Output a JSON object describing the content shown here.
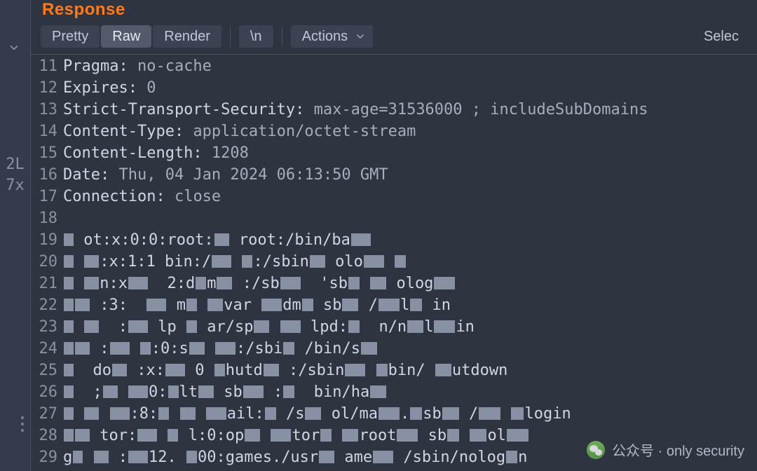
{
  "leftbar": {
    "mark1": "2L",
    "mark2": "7x"
  },
  "header": {
    "title": "Response"
  },
  "toolbar": {
    "pretty": "Pretty",
    "raw": "Raw",
    "render": "Render",
    "newline": "\\n",
    "actions": "Actions",
    "select": "Selec"
  },
  "lines": [
    {
      "n": 11,
      "type": "hdr",
      "key": "Pragma:",
      "val": " no-cache"
    },
    {
      "n": 12,
      "type": "hdr",
      "key": "Expires:",
      "val": " 0"
    },
    {
      "n": 13,
      "type": "hdr",
      "key": "Strict-Transport-Security:",
      "val": " max-age=31536000 ; includeSubDomains"
    },
    {
      "n": 14,
      "type": "hdr",
      "key": "Content-Type:",
      "val": " application/octet-stream"
    },
    {
      "n": 15,
      "type": "hdr",
      "key": "Content-Length:",
      "val": " 1208"
    },
    {
      "n": 16,
      "type": "hdr",
      "key": "Date:",
      "val": " Thu, 04 Jan 2024 06:13:50 GMT"
    },
    {
      "n": 17,
      "type": "hdr",
      "key": "Connection:",
      "val": " close"
    },
    {
      "n": 18,
      "type": "blank",
      "text": ""
    },
    {
      "n": 19,
      "type": "body",
      "text": "▮ ot:x:0:0:root:▮ root:/bin/ba▮"
    },
    {
      "n": 20,
      "type": "body",
      "text": "▮ ▮:x:1:1 bin:/▮ ▮:/sbin▮ olo▮ ▮"
    },
    {
      "n": 21,
      "type": "body",
      "text": "▮ ▮n:x▮  2:d▮m▮ :/sb▮  'sb▮ ▮ olog▮"
    },
    {
      "n": 22,
      "type": "body",
      "text": "▮▮ :3:  ▮ m▮ ▮var ▮dm▮ sb▮ /▮l▮ in"
    },
    {
      "n": 23,
      "type": "body",
      "text": "▮ ▮  :▮ lp ▮ ar/sp▮ ▮ lpd:▮  n/n▮l▮in"
    },
    {
      "n": 24,
      "type": "body",
      "text": "▮▮ :▮ ▮:0:s▮ ▮:/sbi▮ /bin/s▮"
    },
    {
      "n": 25,
      "type": "body",
      "text": "▮  do▮ :x:▮ 0 ▮hutd▮ :/sbin▮ ▮bin/ ▮utdown"
    },
    {
      "n": 26,
      "type": "body",
      "text": "▮  ;▮ ▮0:▮lt▮ sb▮ :▮  bin/ha▮"
    },
    {
      "n": 27,
      "type": "body",
      "text": "▮ ▮ ▮:8:▮ ▮ ▮ail:▮ /s▮ ol/ma▮.▮sb▮ /▮ ▮login"
    },
    {
      "n": 28,
      "type": "body",
      "text": "▮▮ tor:▮ ▮ l:0:op▮ ▮tor▮ ▮root▮ sb▮ ▮ol▮"
    },
    {
      "n": 29,
      "type": "body",
      "text": "g▮ ▮ :▮12. ▮00:games./usr▮ ame▮ /sbin/nolog▮n"
    }
  ],
  "watermark": {
    "label": "公众号 · only security"
  }
}
